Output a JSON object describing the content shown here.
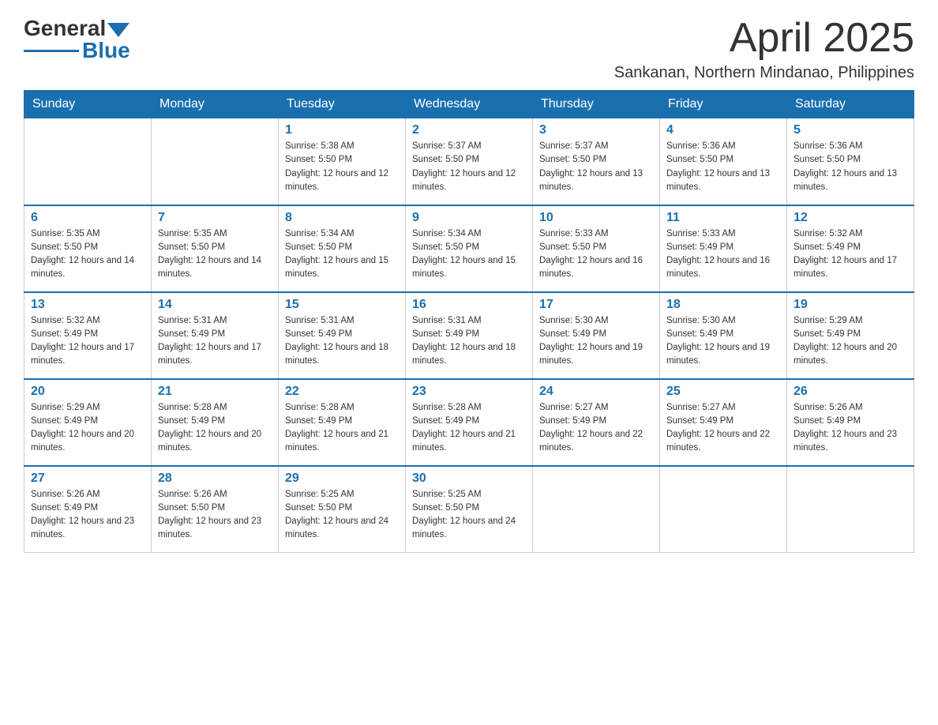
{
  "logo": {
    "general": "General",
    "blue": "Blue"
  },
  "title": {
    "month_year": "April 2025",
    "location": "Sankanan, Northern Mindanao, Philippines"
  },
  "days_of_week": [
    "Sunday",
    "Monday",
    "Tuesday",
    "Wednesday",
    "Thursday",
    "Friday",
    "Saturday"
  ],
  "weeks": [
    [
      {
        "day": "",
        "sunrise": "",
        "sunset": "",
        "daylight": ""
      },
      {
        "day": "",
        "sunrise": "",
        "sunset": "",
        "daylight": ""
      },
      {
        "day": "1",
        "sunrise": "Sunrise: 5:38 AM",
        "sunset": "Sunset: 5:50 PM",
        "daylight": "Daylight: 12 hours and 12 minutes."
      },
      {
        "day": "2",
        "sunrise": "Sunrise: 5:37 AM",
        "sunset": "Sunset: 5:50 PM",
        "daylight": "Daylight: 12 hours and 12 minutes."
      },
      {
        "day": "3",
        "sunrise": "Sunrise: 5:37 AM",
        "sunset": "Sunset: 5:50 PM",
        "daylight": "Daylight: 12 hours and 13 minutes."
      },
      {
        "day": "4",
        "sunrise": "Sunrise: 5:36 AM",
        "sunset": "Sunset: 5:50 PM",
        "daylight": "Daylight: 12 hours and 13 minutes."
      },
      {
        "day": "5",
        "sunrise": "Sunrise: 5:36 AM",
        "sunset": "Sunset: 5:50 PM",
        "daylight": "Daylight: 12 hours and 13 minutes."
      }
    ],
    [
      {
        "day": "6",
        "sunrise": "Sunrise: 5:35 AM",
        "sunset": "Sunset: 5:50 PM",
        "daylight": "Daylight: 12 hours and 14 minutes."
      },
      {
        "day": "7",
        "sunrise": "Sunrise: 5:35 AM",
        "sunset": "Sunset: 5:50 PM",
        "daylight": "Daylight: 12 hours and 14 minutes."
      },
      {
        "day": "8",
        "sunrise": "Sunrise: 5:34 AM",
        "sunset": "Sunset: 5:50 PM",
        "daylight": "Daylight: 12 hours and 15 minutes."
      },
      {
        "day": "9",
        "sunrise": "Sunrise: 5:34 AM",
        "sunset": "Sunset: 5:50 PM",
        "daylight": "Daylight: 12 hours and 15 minutes."
      },
      {
        "day": "10",
        "sunrise": "Sunrise: 5:33 AM",
        "sunset": "Sunset: 5:50 PM",
        "daylight": "Daylight: 12 hours and 16 minutes."
      },
      {
        "day": "11",
        "sunrise": "Sunrise: 5:33 AM",
        "sunset": "Sunset: 5:49 PM",
        "daylight": "Daylight: 12 hours and 16 minutes."
      },
      {
        "day": "12",
        "sunrise": "Sunrise: 5:32 AM",
        "sunset": "Sunset: 5:49 PM",
        "daylight": "Daylight: 12 hours and 17 minutes."
      }
    ],
    [
      {
        "day": "13",
        "sunrise": "Sunrise: 5:32 AM",
        "sunset": "Sunset: 5:49 PM",
        "daylight": "Daylight: 12 hours and 17 minutes."
      },
      {
        "day": "14",
        "sunrise": "Sunrise: 5:31 AM",
        "sunset": "Sunset: 5:49 PM",
        "daylight": "Daylight: 12 hours and 17 minutes."
      },
      {
        "day": "15",
        "sunrise": "Sunrise: 5:31 AM",
        "sunset": "Sunset: 5:49 PM",
        "daylight": "Daylight: 12 hours and 18 minutes."
      },
      {
        "day": "16",
        "sunrise": "Sunrise: 5:31 AM",
        "sunset": "Sunset: 5:49 PM",
        "daylight": "Daylight: 12 hours and 18 minutes."
      },
      {
        "day": "17",
        "sunrise": "Sunrise: 5:30 AM",
        "sunset": "Sunset: 5:49 PM",
        "daylight": "Daylight: 12 hours and 19 minutes."
      },
      {
        "day": "18",
        "sunrise": "Sunrise: 5:30 AM",
        "sunset": "Sunset: 5:49 PM",
        "daylight": "Daylight: 12 hours and 19 minutes."
      },
      {
        "day": "19",
        "sunrise": "Sunrise: 5:29 AM",
        "sunset": "Sunset: 5:49 PM",
        "daylight": "Daylight: 12 hours and 20 minutes."
      }
    ],
    [
      {
        "day": "20",
        "sunrise": "Sunrise: 5:29 AM",
        "sunset": "Sunset: 5:49 PM",
        "daylight": "Daylight: 12 hours and 20 minutes."
      },
      {
        "day": "21",
        "sunrise": "Sunrise: 5:28 AM",
        "sunset": "Sunset: 5:49 PM",
        "daylight": "Daylight: 12 hours and 20 minutes."
      },
      {
        "day": "22",
        "sunrise": "Sunrise: 5:28 AM",
        "sunset": "Sunset: 5:49 PM",
        "daylight": "Daylight: 12 hours and 21 minutes."
      },
      {
        "day": "23",
        "sunrise": "Sunrise: 5:28 AM",
        "sunset": "Sunset: 5:49 PM",
        "daylight": "Daylight: 12 hours and 21 minutes."
      },
      {
        "day": "24",
        "sunrise": "Sunrise: 5:27 AM",
        "sunset": "Sunset: 5:49 PM",
        "daylight": "Daylight: 12 hours and 22 minutes."
      },
      {
        "day": "25",
        "sunrise": "Sunrise: 5:27 AM",
        "sunset": "Sunset: 5:49 PM",
        "daylight": "Daylight: 12 hours and 22 minutes."
      },
      {
        "day": "26",
        "sunrise": "Sunrise: 5:26 AM",
        "sunset": "Sunset: 5:49 PM",
        "daylight": "Daylight: 12 hours and 23 minutes."
      }
    ],
    [
      {
        "day": "27",
        "sunrise": "Sunrise: 5:26 AM",
        "sunset": "Sunset: 5:49 PM",
        "daylight": "Daylight: 12 hours and 23 minutes."
      },
      {
        "day": "28",
        "sunrise": "Sunrise: 5:26 AM",
        "sunset": "Sunset: 5:50 PM",
        "daylight": "Daylight: 12 hours and 23 minutes."
      },
      {
        "day": "29",
        "sunrise": "Sunrise: 5:25 AM",
        "sunset": "Sunset: 5:50 PM",
        "daylight": "Daylight: 12 hours and 24 minutes."
      },
      {
        "day": "30",
        "sunrise": "Sunrise: 5:25 AM",
        "sunset": "Sunset: 5:50 PM",
        "daylight": "Daylight: 12 hours and 24 minutes."
      },
      {
        "day": "",
        "sunrise": "",
        "sunset": "",
        "daylight": ""
      },
      {
        "day": "",
        "sunrise": "",
        "sunset": "",
        "daylight": ""
      },
      {
        "day": "",
        "sunrise": "",
        "sunset": "",
        "daylight": ""
      }
    ]
  ]
}
